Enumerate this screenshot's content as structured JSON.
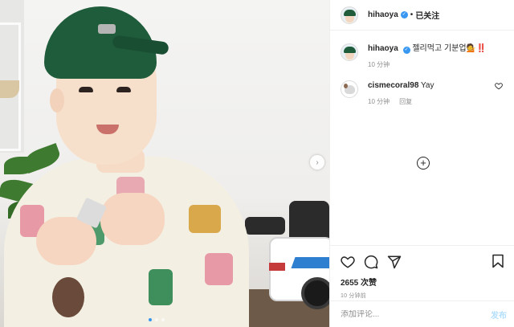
{
  "post": {
    "author": "hihaoya",
    "follow_status": "已关注",
    "separator": "•",
    "verified_mark": "✓"
  },
  "comments": [
    {
      "username": "hihaoya",
      "text": "젤리먹고 기분업💁‼️",
      "time": "10 分钟",
      "avatar": "kid-avatar",
      "verified": true
    },
    {
      "username": "cismecoral98",
      "text": "Yay",
      "time": "10 分钟",
      "reply_label": "回复",
      "avatar": "dog-avatar"
    }
  ],
  "load_more_icon": "+",
  "actions": {
    "icons": [
      "heart-icon",
      "comment-icon",
      "share-icon",
      "bookmark-icon"
    ],
    "likes_count": "2655",
    "likes_label": "次赞",
    "time_ago": "10 分钟前"
  },
  "add_comment": {
    "placeholder": "添加评论...",
    "post_label": "发布"
  },
  "media": {
    "next_icon": "›",
    "carousel_count": 3,
    "active_index": 0
  },
  "colors": {
    "accent": "#3897f0",
    "post_disabled": "#b2dffc",
    "secondary_text": "#8e8e8e",
    "border": "#efefef"
  }
}
